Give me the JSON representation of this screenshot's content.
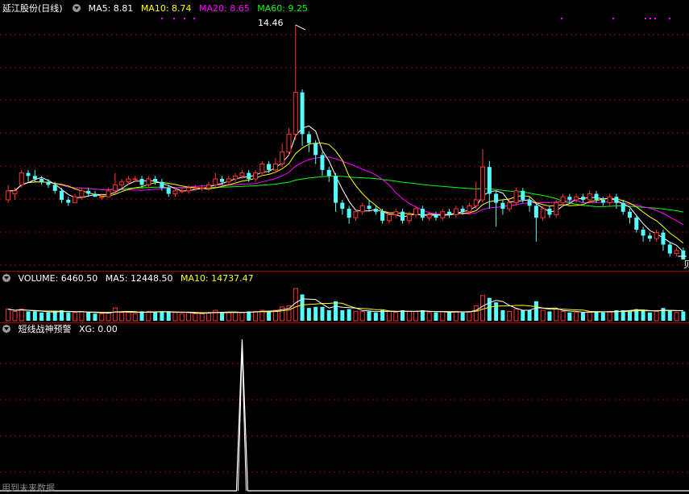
{
  "price_panel": {
    "stock_name": "延江股份(日线)",
    "ma5_label": "MA5: 8.81",
    "ma10_label": "MA10: 8.74",
    "ma20_label": "MA20: 8.65",
    "ma60_label": "MA60: 9.25",
    "high_marker": "14.46",
    "edge_marker": "贝"
  },
  "volume_panel": {
    "title": "VOLUME: 6460.50",
    "ma5_label": "MA5: 12448.50",
    "ma10_label": "MA10: 14737.47"
  },
  "indicator_panel": {
    "title": "短线战神预警",
    "xg_label": "XG: 0.00"
  },
  "footer_text": "用到未来数据",
  "colors": {
    "up": "#ff3232",
    "down": "#54ffff",
    "ma5": "#ffffff",
    "ma10": "#ffff00",
    "ma20": "#ff00ff",
    "ma60": "#00ff00",
    "grid": "#a00000"
  },
  "chart_data": [
    {
      "type": "candlestick",
      "price_range": [
        6.6,
        14.7
      ],
      "highlighted_value": 14.46,
      "candles": [
        [
          8.6,
          8.9,
          9.1,
          8.5
        ],
        [
          8.8,
          8.9,
          9.0,
          8.6
        ],
        [
          9.1,
          9.5,
          9.6,
          9.0
        ],
        [
          9.5,
          9.4,
          9.6,
          9.2
        ],
        [
          9.4,
          9.3,
          9.6,
          9.2
        ],
        [
          9.3,
          9.2,
          9.4,
          9.1
        ],
        [
          9.2,
          9.1,
          9.3,
          9.0
        ],
        [
          9.1,
          8.9,
          9.2,
          8.8
        ],
        [
          8.9,
          8.6,
          9.0,
          8.5
        ],
        [
          8.6,
          8.5,
          8.7,
          8.4
        ],
        [
          8.5,
          8.7,
          8.8,
          8.5
        ],
        [
          8.7,
          8.9,
          9.0,
          8.6
        ],
        [
          8.9,
          8.8,
          9.0,
          8.7
        ],
        [
          8.8,
          8.7,
          8.9,
          8.7
        ],
        [
          8.7,
          8.7,
          8.8,
          8.6
        ],
        [
          8.7,
          8.9,
          9.0,
          8.7
        ],
        [
          8.9,
          9.1,
          9.5,
          8.8
        ],
        [
          9.1,
          9.2,
          9.3,
          9.0
        ],
        [
          9.2,
          9.3,
          9.4,
          9.1
        ],
        [
          9.3,
          9.3,
          9.4,
          9.2
        ],
        [
          9.3,
          9.1,
          9.4,
          9.0
        ],
        [
          9.1,
          9.3,
          9.4,
          9.0
        ],
        [
          9.3,
          9.2,
          9.4,
          9.1
        ],
        [
          9.2,
          9.0,
          9.3,
          8.9
        ],
        [
          9.0,
          8.8,
          9.1,
          8.7
        ],
        [
          8.8,
          8.9,
          9.0,
          8.7
        ],
        [
          8.9,
          8.9,
          9.0,
          8.8
        ],
        [
          8.9,
          9.0,
          9.1,
          8.8
        ],
        [
          9.0,
          9.0,
          9.1,
          8.9
        ],
        [
          9.0,
          9.0,
          9.1,
          8.9
        ],
        [
          9.0,
          9.1,
          9.2,
          8.9
        ],
        [
          9.1,
          9.3,
          9.5,
          9.0
        ],
        [
          9.3,
          9.2,
          9.4,
          9.1
        ],
        [
          9.2,
          9.3,
          9.4,
          9.1
        ],
        [
          9.3,
          9.4,
          9.5,
          9.2
        ],
        [
          9.4,
          9.5,
          9.6,
          9.3
        ],
        [
          9.5,
          9.3,
          9.6,
          9.2
        ],
        [
          9.3,
          9.5,
          9.6,
          9.2
        ],
        [
          9.5,
          9.8,
          9.9,
          9.4
        ],
        [
          9.8,
          9.6,
          9.9,
          9.5
        ],
        [
          9.6,
          9.8,
          10.0,
          9.5
        ],
        [
          9.8,
          10.2,
          10.5,
          9.7
        ],
        [
          10.2,
          10.8,
          11.0,
          10.1
        ],
        [
          10.8,
          12.2,
          14.46,
          10.6
        ],
        [
          12.2,
          10.8,
          12.3,
          10.4
        ],
        [
          10.8,
          10.5,
          10.9,
          10.2
        ],
        [
          10.5,
          10.1,
          10.6,
          9.8
        ],
        [
          10.1,
          9.6,
          10.2,
          9.4
        ],
        [
          9.6,
          9.4,
          9.7,
          9.2
        ],
        [
          9.4,
          8.5,
          9.5,
          8.2
        ],
        [
          8.5,
          8.3,
          8.6,
          8.1
        ],
        [
          8.3,
          8.0,
          8.4,
          7.8
        ],
        [
          8.0,
          8.2,
          8.3,
          7.9
        ],
        [
          8.2,
          8.4,
          8.5,
          8.1
        ],
        [
          8.4,
          8.3,
          8.6,
          8.2
        ],
        [
          8.3,
          8.2,
          8.4,
          8.1
        ],
        [
          8.2,
          7.9,
          8.3,
          7.8
        ],
        [
          7.9,
          8.1,
          8.2,
          7.8
        ],
        [
          8.1,
          8.2,
          8.3,
          8.0
        ],
        [
          8.2,
          7.9,
          8.3,
          7.8
        ],
        [
          7.9,
          8.1,
          8.2,
          7.8
        ],
        [
          8.1,
          8.3,
          8.4,
          8.0
        ],
        [
          8.3,
          8.0,
          8.4,
          7.9
        ],
        [
          8.0,
          8.1,
          8.2,
          7.9
        ],
        [
          8.1,
          8.0,
          8.2,
          7.9
        ],
        [
          8.0,
          8.2,
          8.3,
          7.9
        ],
        [
          8.2,
          8.1,
          8.3,
          8.0
        ],
        [
          8.1,
          8.3,
          8.4,
          8.0
        ],
        [
          8.3,
          8.2,
          8.4,
          8.1
        ],
        [
          8.2,
          8.4,
          8.5,
          8.1
        ],
        [
          8.4,
          8.6,
          9.2,
          8.3
        ],
        [
          8.6,
          9.7,
          10.3,
          8.5
        ],
        [
          9.7,
          8.8,
          9.9,
          8.3
        ],
        [
          8.8,
          8.5,
          8.9,
          7.7
        ],
        [
          8.5,
          8.3,
          8.6,
          8.1
        ],
        [
          8.3,
          8.5,
          8.6,
          8.2
        ],
        [
          8.5,
          8.9,
          9.0,
          8.4
        ],
        [
          8.9,
          8.6,
          9.0,
          8.5
        ],
        [
          8.6,
          8.4,
          8.7,
          8.2
        ],
        [
          8.4,
          8.0,
          8.5,
          7.2
        ],
        [
          8.0,
          8.3,
          8.4,
          7.9
        ],
        [
          8.3,
          8.1,
          8.4,
          8.0
        ],
        [
          8.1,
          8.5,
          8.6,
          8.0
        ],
        [
          8.5,
          8.7,
          8.8,
          8.4
        ],
        [
          8.7,
          8.6,
          8.8,
          8.5
        ],
        [
          8.6,
          8.7,
          8.8,
          8.5
        ],
        [
          8.7,
          8.6,
          8.8,
          8.5
        ],
        [
          8.6,
          8.8,
          8.9,
          8.5
        ],
        [
          8.8,
          8.6,
          8.9,
          8.5
        ],
        [
          8.6,
          8.5,
          8.7,
          8.4
        ],
        [
          8.5,
          8.7,
          8.8,
          8.4
        ],
        [
          8.7,
          8.5,
          8.8,
          8.3
        ],
        [
          8.5,
          8.2,
          8.6,
          8.1
        ],
        [
          8.2,
          8.0,
          8.3,
          7.8
        ],
        [
          8.0,
          7.6,
          8.1,
          7.5
        ],
        [
          7.6,
          7.4,
          7.7,
          7.2
        ],
        [
          7.4,
          7.3,
          7.5,
          7.2
        ],
        [
          7.3,
          7.5,
          7.6,
          7.2
        ],
        [
          7.5,
          7.1,
          7.6,
          6.9
        ],
        [
          7.1,
          6.8,
          7.2,
          6.7
        ],
        [
          6.8,
          6.9,
          7.0,
          6.7
        ],
        [
          6.9,
          6.6,
          7.0,
          6.6
        ]
      ],
      "ma_values": {
        "MA5": 8.81,
        "MA10": 8.74,
        "MA20": 8.65,
        "MA60": 9.25
      }
    },
    {
      "type": "bar",
      "name": "VOLUME",
      "volume_value": 6460.5,
      "MA5": 12448.5,
      "MA10": 14737.47
    },
    {
      "type": "line",
      "name": "XG",
      "value": 0.0,
      "spike_at_index": 35
    }
  ]
}
